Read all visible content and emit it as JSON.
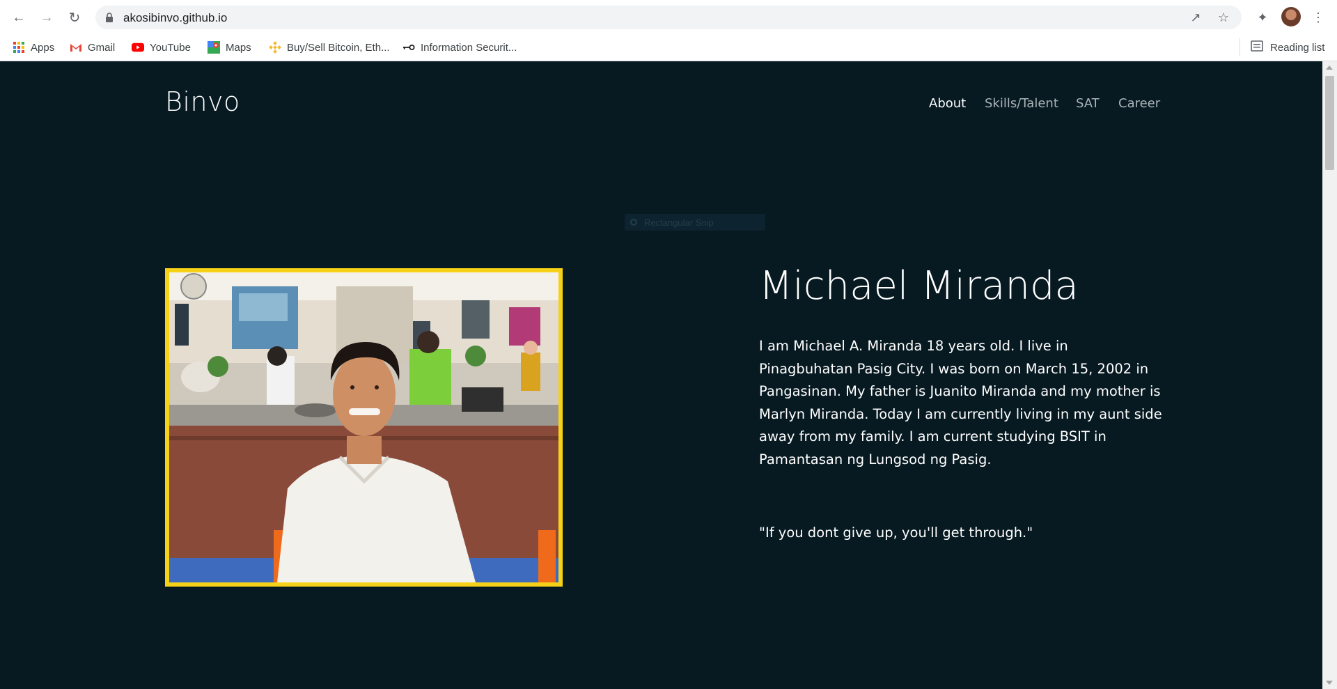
{
  "browser": {
    "url": "akosibinvo.github.io",
    "bookmarks": [
      {
        "label": "Apps",
        "icon": "apps-grid-icon"
      },
      {
        "label": "Gmail",
        "icon": "gmail-icon"
      },
      {
        "label": "YouTube",
        "icon": "youtube-icon"
      },
      {
        "label": "Maps",
        "icon": "maps-icon"
      },
      {
        "label": "Buy/Sell Bitcoin, Eth...",
        "icon": "binance-icon"
      },
      {
        "label": "Information Securit...",
        "icon": "key-icon"
      }
    ],
    "reading_list": "Reading list"
  },
  "site": {
    "brand": "Binvo",
    "nav": [
      {
        "label": "About",
        "active": true
      },
      {
        "label": "Skills/Talent",
        "active": false
      },
      {
        "label": "SAT",
        "active": false
      },
      {
        "label": "Career",
        "active": false
      }
    ],
    "snip_label": "Rectangular Snip"
  },
  "hero": {
    "name": "Michael Miranda",
    "bio": "I am Michael A. Miranda 18 years old. I live in Pinagbuhatan Pasig City. I was born on March 15, 2002 in Pangasinan. My father is Juanito Miranda and my mother is Marlyn Miranda. Today I am currently living in my aunt side away from my family. I am current studying BSIT in Pamantasan ng Lungsod ng Pasig.",
    "quote": "\"If you dont give up, you'll get through.\""
  },
  "colors": {
    "page_bg": "#071921",
    "photo_border": "#f7d117",
    "nav_active": "#ffffff",
    "nav_inactive": "#aab4b8"
  }
}
